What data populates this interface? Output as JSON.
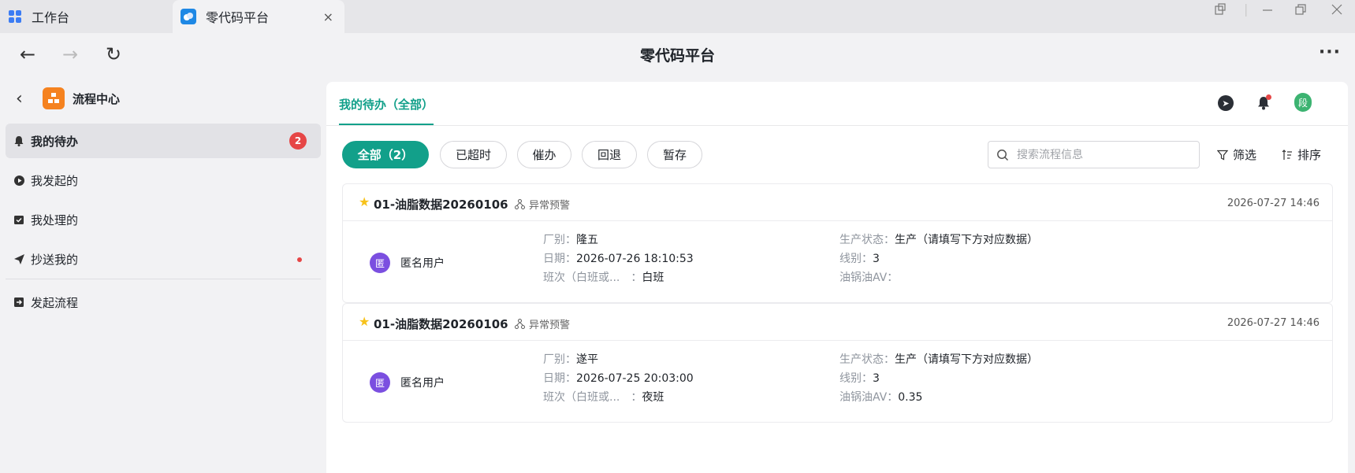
{
  "window": {
    "tabs": [
      {
        "label": "工作台",
        "icon": "grid-apps-icon"
      },
      {
        "label": "零代码平台",
        "icon": "cloud-app-icon"
      }
    ],
    "tab_close": "×"
  },
  "navbar": {
    "title": "零代码平台",
    "back": "←",
    "forward": "→",
    "refresh": "↻",
    "more": "···"
  },
  "sidebar": {
    "title": "流程中心",
    "items": [
      {
        "label": "我的待办",
        "badge": "2"
      },
      {
        "label": "我发起的"
      },
      {
        "label": "我处理的"
      },
      {
        "label": "抄送我的"
      },
      {
        "label": "发起流程"
      }
    ]
  },
  "main": {
    "tab": "我的待办（全部）",
    "avatar": "段",
    "filters": [
      "全部（2）",
      "已超时",
      "催办",
      "回退",
      "暂存"
    ],
    "search_placeholder": "搜索流程信息",
    "filter_label": "筛选",
    "sort_label": "排序"
  },
  "cards": [
    {
      "title": "01-油脂数据20260106",
      "tag": "异常预警",
      "time": "2026-07-27 14:46",
      "user": "匿名用户",
      "user_avatar": "匿",
      "f1_k": "厂别：",
      "f1_v": "隆五",
      "f2_k": "日期：",
      "f2_v": "2026-07-26 18:10:53",
      "f3_k": "班次（白班或...　：",
      "f3_v": "白班",
      "f4_k": "生产状态：",
      "f4_v": "生产（请填写下方对应数据）",
      "f5_k": "线别：",
      "f5_v": "3",
      "f6_k": "油锅油AV：",
      "f6_v": ""
    },
    {
      "title": "01-油脂数据20260106",
      "tag": "异常预警",
      "time": "2026-07-27 14:46",
      "user": "匿名用户",
      "user_avatar": "匿",
      "f1_k": "厂别：",
      "f1_v": "遂平",
      "f2_k": "日期：",
      "f2_v": "2026-07-25 20:03:00",
      "f3_k": "班次（白班或...　：",
      "f3_v": "夜班",
      "f4_k": "生产状态：",
      "f4_v": "生产（请填写下方对应数据）",
      "f5_k": "线别：",
      "f5_v": "3",
      "f6_k": "油锅油AV：",
      "f6_v": "0.35"
    }
  ]
}
